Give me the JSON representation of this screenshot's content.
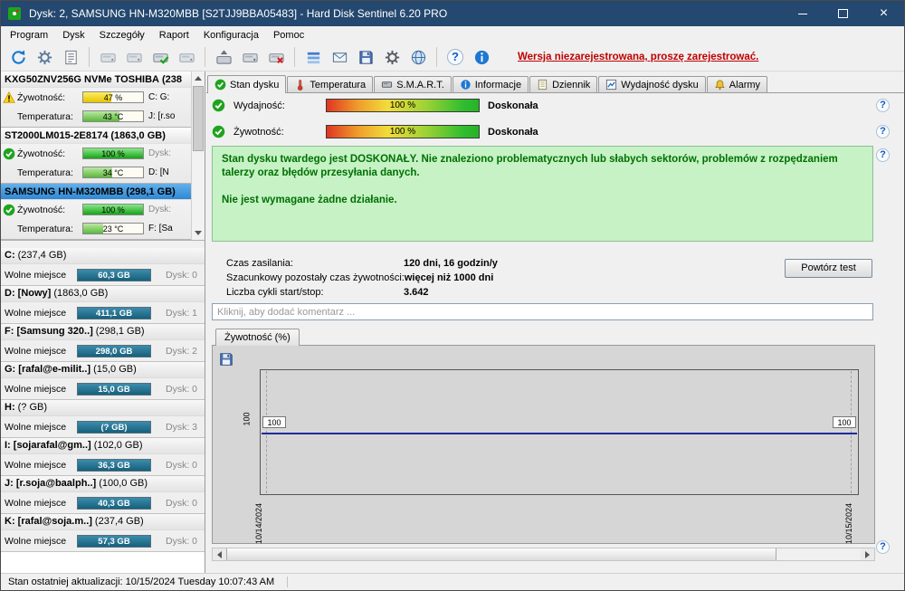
{
  "window": {
    "title": "Dysk: 2, SAMSUNG HN-M320MBB [S2TJJ9BBA05483]  -  Hard Disk Sentinel 6.20 PRO"
  },
  "menu": {
    "items": [
      "Program",
      "Dysk",
      "Szczegóły",
      "Raport",
      "Konfiguracja",
      "Pomoc"
    ]
  },
  "toolbar": {
    "register_link": "Wersja niezarejestrowana, proszę zarejestrować.",
    "icons": [
      "refresh-icon",
      "auto-refresh-icon",
      "report-icon",
      "disk-prev-icon",
      "disk-next-icon",
      "disk-ok-icon",
      "disk-small-icon",
      "eject-disk-icon",
      "surface-disk-icon",
      "remove-disk-icon",
      "panel-view-icon",
      "email-report-icon",
      "save-report-icon",
      "settings-gear-icon",
      "web-icon",
      "help-icon",
      "info-icon"
    ]
  },
  "colors": {
    "titlebar": "#24486f",
    "selected_disk": "#2f87d4",
    "health_green": "#17a317",
    "warning_yellow": "#ffd21f",
    "partition_bar": "#16607c",
    "note_bg": "#c6f2c6",
    "note_text": "#007000",
    "register_red": "#c00000",
    "chart_line": "#202a96"
  },
  "sidebar": {
    "disks": [
      {
        "name": "KXG50ZNV256G NVMe TOSHIBA",
        "capacity": "(238",
        "status": "warning",
        "health_label": "Żywotność:",
        "health_value": "47 %",
        "health_pct": 47,
        "temp_label": "Temperatura:",
        "temp_value": "43 °C",
        "temp_pct": 61,
        "right_top": "C: G:",
        "right_bottom": "J: [r.so"
      },
      {
        "name": "ST2000LM015-2E8174",
        "capacity": "(1863,0 GB)",
        "status": "ok",
        "health_label": "Żywotność:",
        "health_value": "100 %",
        "health_pct": 100,
        "temp_label": "Temperatura:",
        "temp_value": "34 °C",
        "temp_pct": 48,
        "right_top": "Dysk:",
        "right_bottom": "D: [N"
      },
      {
        "name": "SAMSUNG HN-M320MBB",
        "capacity": "(298,1 GB)",
        "status": "ok",
        "health_label": "Żywotność:",
        "health_value": "100 %",
        "health_pct": 100,
        "temp_label": "Temperatura:",
        "temp_value": "23 °C",
        "temp_pct": 33,
        "right_top": "Dysk:",
        "right_bottom": "F: [Sa"
      }
    ],
    "partitions": [
      {
        "name": "C:",
        "capacity": "(237,4 GB)",
        "free_label": "Wolne miejsce",
        "free_value": "60,3 GB",
        "disk": "Dysk: 0"
      },
      {
        "name": "D: [Nowy]",
        "capacity": "(1863,0 GB)",
        "free_label": "Wolne miejsce",
        "free_value": "411,1 GB",
        "disk": "Dysk: 1"
      },
      {
        "name": "F: [Samsung 320..]",
        "capacity": "(298,1 GB)",
        "free_label": "Wolne miejsce",
        "free_value": "298,0 GB",
        "disk": "Dysk: 2"
      },
      {
        "name": "G: [rafal@e-milit..]",
        "capacity": "(15,0 GB)",
        "free_label": "Wolne miejsce",
        "free_value": "15,0 GB",
        "disk": "Dysk: 0"
      },
      {
        "name": "H:",
        "capacity": "(? GB)",
        "free_label": "Wolne miejsce",
        "free_value": "(? GB)",
        "disk": "Dysk: 3"
      },
      {
        "name": "I: [sojarafal@gm..]",
        "capacity": "(102,0 GB)",
        "free_label": "Wolne miejsce",
        "free_value": "36,3 GB",
        "disk": "Dysk: 0"
      },
      {
        "name": "J: [r.soja@baalph..]",
        "capacity": "(100,0 GB)",
        "free_label": "Wolne miejsce",
        "free_value": "40,3 GB",
        "disk": "Dysk: 0"
      },
      {
        "name": "K: [rafal@soja.m..]",
        "capacity": "(237,4 GB)",
        "free_label": "Wolne miejsce",
        "free_value": "57,3 GB",
        "disk": "Dysk: 0"
      }
    ]
  },
  "tabs": [
    {
      "label": "Stan dysku",
      "active": true
    },
    {
      "label": "Temperatura",
      "active": false
    },
    {
      "label": "S.M.A.R.T.",
      "active": false
    },
    {
      "label": "Informacje",
      "active": false
    },
    {
      "label": "Dziennik",
      "active": false
    },
    {
      "label": "Wydajność dysku",
      "active": false
    },
    {
      "label": "Alarmy",
      "active": false
    }
  ],
  "status_panel": {
    "rows": [
      {
        "label": "Wydajność:",
        "value": "100 %",
        "pct": 100,
        "rating": "Doskonała"
      },
      {
        "label": "Żywotność:",
        "value": "100 %",
        "pct": 100,
        "rating": "Doskonała"
      }
    ],
    "summary_p1": "Stan dysku twardego jest DOSKONAŁY. Nie znaleziono problematycznych lub słabych sektorów, problemów z rozpędzaniem talerzy oraz błędów przesyłania danych.",
    "summary_p2": "Nie jest wymagane żadne działanie.",
    "stats": [
      {
        "label": "Czas zasilania:",
        "value": "120 dni, 16 godzin/y"
      },
      {
        "label": "Szacunkowy pozostały czas żywotności:",
        "value": "więcej niż 1000 dni"
      },
      {
        "label": "Liczba cykli start/stop:",
        "value": "3.642"
      }
    ],
    "retest_button": "Powtórz test",
    "comment_placeholder": "Kliknij, aby dodać komentarz ..."
  },
  "chart": {
    "tab_label": "Żywotność (%)",
    "y_tick": "100",
    "point_label_left": "100",
    "point_label_right": "100",
    "x_labels": [
      "10/14/2024",
      "10/15/2024"
    ]
  },
  "chart_data": {
    "type": "line",
    "title": "Żywotność (%)",
    "x": [
      "10/14/2024",
      "10/15/2024"
    ],
    "values": [
      100,
      100
    ],
    "ylabel": "Żywotność (%)",
    "ylim": [
      0,
      200
    ],
    "legend_position": "none",
    "grid": "dashed-vertical-at-ticks"
  },
  "statusbar": {
    "text": "Stan ostatniej aktualizacji: 10/15/2024 Tuesday 10:07:43 AM"
  }
}
